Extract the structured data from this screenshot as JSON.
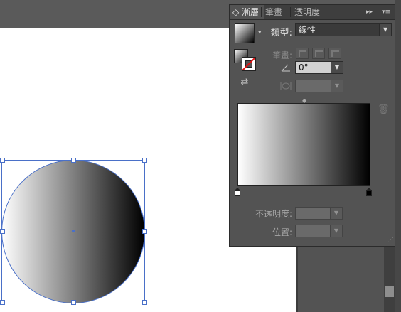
{
  "panel": {
    "tabs": [
      {
        "label": "漸層",
        "prefix": "◇"
      },
      {
        "label": "筆畫"
      },
      {
        "label": "透明度"
      }
    ],
    "controls": {
      "expand": "▸▸",
      "menu": "▾≡"
    },
    "type_label": "類型:",
    "type_value": "線性",
    "stroke_label": "筆畫:",
    "angle_icon": "angle-icon",
    "angle_value": "0°",
    "aspect_icon": "aspect-ratio-icon",
    "aspect_value": "",
    "opacity_label": "不透明度:",
    "opacity_value": "",
    "location_label": "位置:",
    "location_value": ""
  },
  "gradient": {
    "start_color": "#ffffff",
    "end_color": "#000000",
    "stops": [
      {
        "color": "#ffffff",
        "location": 0
      },
      {
        "color": "#000000",
        "location": 100
      }
    ]
  },
  "colors": {
    "selection": "#4a70c8",
    "reverse_stroke_line": "#dd1111"
  }
}
